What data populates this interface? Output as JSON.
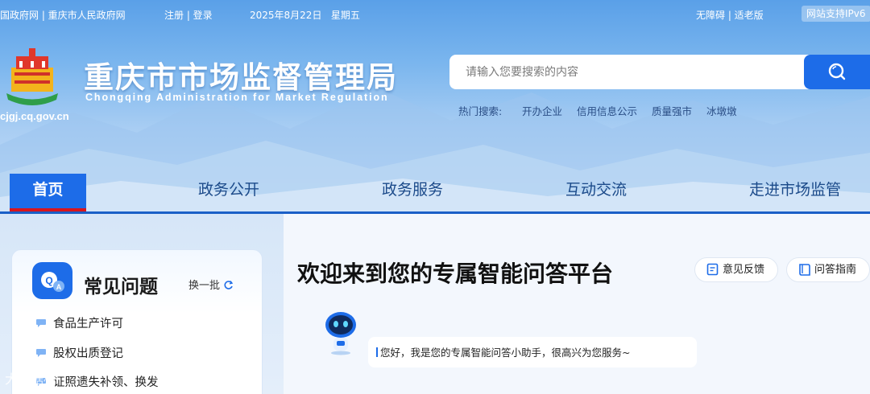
{
  "topbar": {
    "gov_links": "国政府网 | 重庆市人民政府网",
    "account": "注册 | 登录",
    "date": "2025年8月22日",
    "weekday": "星期五",
    "accessibility": "无障碍 | 适老版",
    "ipv6": "网站支持IPv6"
  },
  "brand": {
    "title": "重庆市市场监督管理局",
    "subtitle": "Chongqing Administration for Market Regulation",
    "domain": "cjgj.cq.gov.cn",
    "logo_icon": "emblem-logo-icon"
  },
  "search": {
    "placeholder": "请输入您要搜索的内容",
    "button_icon": "search-icon",
    "hot_label": "热门搜索:",
    "hot_terms": [
      "开办企业",
      "信用信息公示",
      "质量强市",
      "冰墩墩"
    ]
  },
  "nav": {
    "items": [
      "首页",
      "政务公开",
      "政务服务",
      "互动交流",
      "走进市场监管"
    ],
    "active": "首页"
  },
  "faq": {
    "title": "常见问题",
    "refresh_label": "换一批",
    "items": [
      "食品生产许可",
      "股权出质登记",
      "证照遗失补领、换发"
    ]
  },
  "assistant": {
    "welcome": "欢迎来到您的专属智能问答平台",
    "feedback_label": "意见反馈",
    "guide_label": "问答指南",
    "greeting": "您好，我是您的专属智能问答小助手，很高兴为您服务~"
  },
  "watermark": "大数据标",
  "colors": {
    "primary": "#1d6ce8",
    "nav_active_border": "#d8151d",
    "nav_text": "#1b4a8a"
  }
}
